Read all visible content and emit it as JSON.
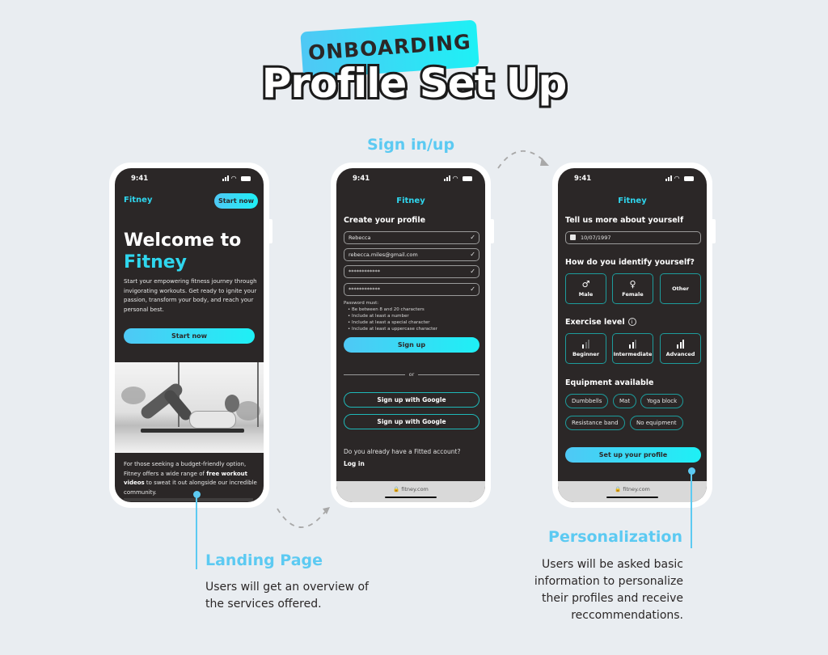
{
  "header": {
    "tag": "ONBOARDING",
    "title": "Profile Set Up"
  },
  "sections": {
    "signin": "Sign in/up",
    "landing": {
      "title": "Landing Page",
      "text_lines": [
        "Users will get an overview of",
        "the services offered."
      ]
    },
    "personalization": {
      "title": "Personalization",
      "text_lines": [
        "Users will be asked basic",
        "information to personalize",
        "their profiles and receive",
        "reccommendations."
      ]
    }
  },
  "status_bar": {
    "time": "9:41"
  },
  "phone_landing": {
    "brand": "Fitney",
    "top_button": "Start now",
    "headline_line1": "Welcome to",
    "headline_line2": "Fitney",
    "description": "Start your empowering fitness journey through invigorating workouts. Get ready to ignite your passion, transform your body, and reach your personal best.",
    "cta_button": "Start now",
    "photo_alt": "woman-doing-crunches",
    "bottom_text_1": "For those seeking a budget-friendly option, Fitney offers a wide range of ",
    "bottom_text_bold": "free workout videos",
    "bottom_text_2": " to sweat it out alongside our incredible community."
  },
  "phone_signup": {
    "brand": "Fitney",
    "heading": "Create your profile",
    "fields": [
      {
        "name": "name",
        "value": "Rebecca"
      },
      {
        "name": "email",
        "value": "rebecca.miles@gmail.com"
      },
      {
        "name": "password",
        "value": "************"
      },
      {
        "name": "confirm-password",
        "value": "************"
      }
    ],
    "password_rules_title": "Password must:",
    "password_rules": [
      "Be between 8 and 20 characters",
      "Include at least a number",
      "Include at least a special character",
      "Include at least a uppercase character"
    ],
    "signup_button": "Sign up",
    "divider": "or",
    "google_button_1": "Sign up with Google",
    "google_button_2": "Sign up with Google",
    "account_question": "Do you already have a Fitted account?",
    "login_link": "Log in",
    "url": "🔒 fitney.com"
  },
  "phone_profile": {
    "brand": "Fitney",
    "heading": "Tell us more about yourself",
    "birthdate": "10/07/1997",
    "gender_heading": "How do you identify yourself?",
    "gender_options": [
      {
        "label": "Male",
        "icon": "♂"
      },
      {
        "label": "Female",
        "icon": "♀"
      },
      {
        "label": "Other",
        "icon": ""
      }
    ],
    "exercise_heading": "Exercise level",
    "exercise_options": [
      {
        "label": "Beginner",
        "level": 1
      },
      {
        "label": "Intermediate",
        "level": 2
      },
      {
        "label": "Advanced",
        "level": 3
      }
    ],
    "equipment_heading": "Equipment available",
    "equipment": [
      "Dumbbells",
      "Mat",
      "Yoga block",
      "Resistance band",
      "No equipment"
    ],
    "setup_button": "Set up your profile",
    "url": "🔒 fitney.com"
  },
  "colors": {
    "accent": "#5ccaf2",
    "gradient_start": "#4fc8f5",
    "gradient_end": "#1ef0f5",
    "screen_bg": "#2b2727",
    "page_bg": "#e9edf1",
    "option_border": "#1d9c9c"
  }
}
